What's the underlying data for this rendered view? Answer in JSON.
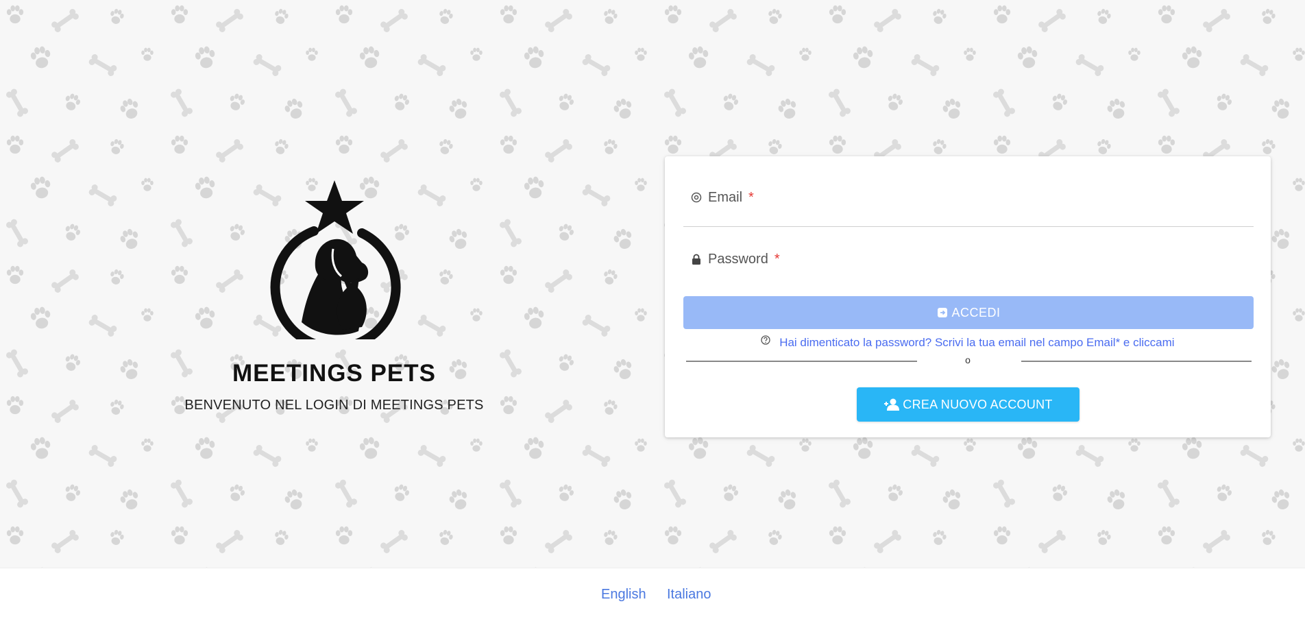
{
  "brand": {
    "title": "MEETINGS PETS",
    "subtitle": "BENVENUTO NEL LOGIN DI MEETINGS PETS",
    "logo_icon": "paw-star-pets-logo-icon"
  },
  "login_form": {
    "email_label": "Email",
    "email_icon": "at-icon",
    "email_required_mark": "*",
    "password_label": "Password",
    "password_icon": "lock-icon",
    "password_required_mark": "*",
    "login_button_label": "ACCEDI",
    "login_button_icon": "login-icon",
    "forgot_password_text": "Hai dimenticato la password? Scrivi la tua email nel campo Email* e cliccami",
    "forgot_password_icon": "question-icon",
    "or_text": "o",
    "create_account_label": "CREA NUOVO ACCOUNT",
    "create_account_icon": "add-user-icon"
  },
  "footer": {
    "languages": [
      "English",
      "Italiano"
    ]
  },
  "colors": {
    "login_button": "#98b9f7",
    "create_button": "#29b6f6",
    "link": "#4a6cf0",
    "required": "#e53935",
    "background_pattern": "#f7f7f7"
  }
}
